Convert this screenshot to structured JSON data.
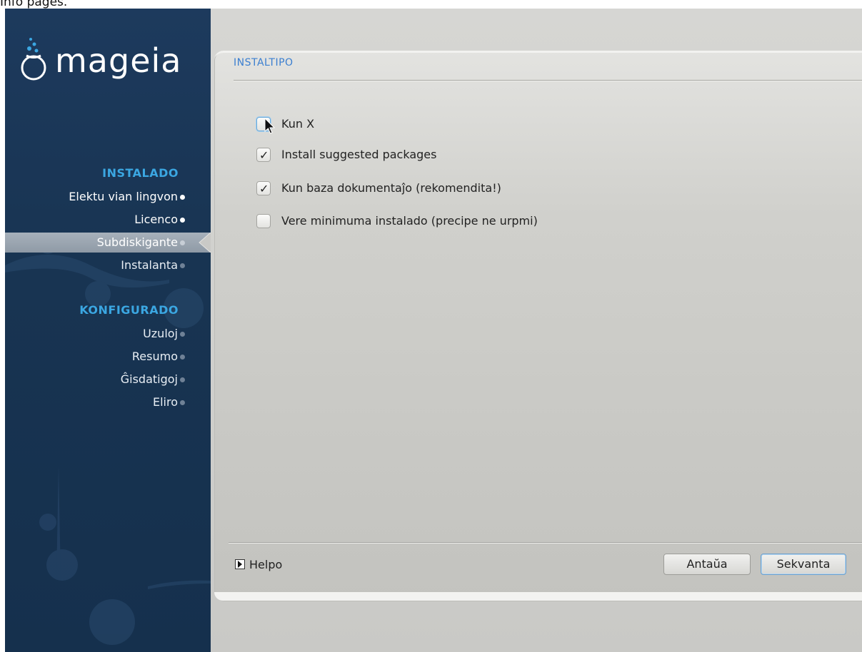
{
  "top_caption": "Info pages.",
  "brand": {
    "name": "mageia"
  },
  "sidebar": {
    "sections": [
      {
        "title": "INSTALADO",
        "steps": [
          {
            "label": "Elektu vian lingvon",
            "state": "done"
          },
          {
            "label": "Licenco",
            "state": "done"
          },
          {
            "label": "Subdiskigante",
            "state": "current"
          },
          {
            "label": "Instalanta",
            "state": "pending"
          }
        ]
      },
      {
        "title": "KONFIGURADO",
        "steps": [
          {
            "label": "Uzuloj",
            "state": "pending"
          },
          {
            "label": "Resumo",
            "state": "pending"
          },
          {
            "label": "Ĝisdatigoj",
            "state": "pending"
          },
          {
            "label": "Eliro",
            "state": "pending"
          }
        ]
      }
    ]
  },
  "panel": {
    "title": "INSTALTIPO",
    "options": [
      {
        "label": "Kun X",
        "checked": false
      },
      {
        "label": "Install suggested packages",
        "checked": true
      },
      {
        "label": "Kun baza dokumentaĵo (rekomendita!)",
        "checked": true
      },
      {
        "label": "Vere minimuma instalado (precipe ne urpmi)",
        "checked": false
      }
    ]
  },
  "footer": {
    "help_label": "Helpo",
    "back_label": "Antaŭa",
    "next_label": "Sekvanta"
  },
  "colors": {
    "sidebar_bg": "#183452",
    "section_title": "#3ba7e2",
    "panel_title": "#3b7fd0"
  }
}
